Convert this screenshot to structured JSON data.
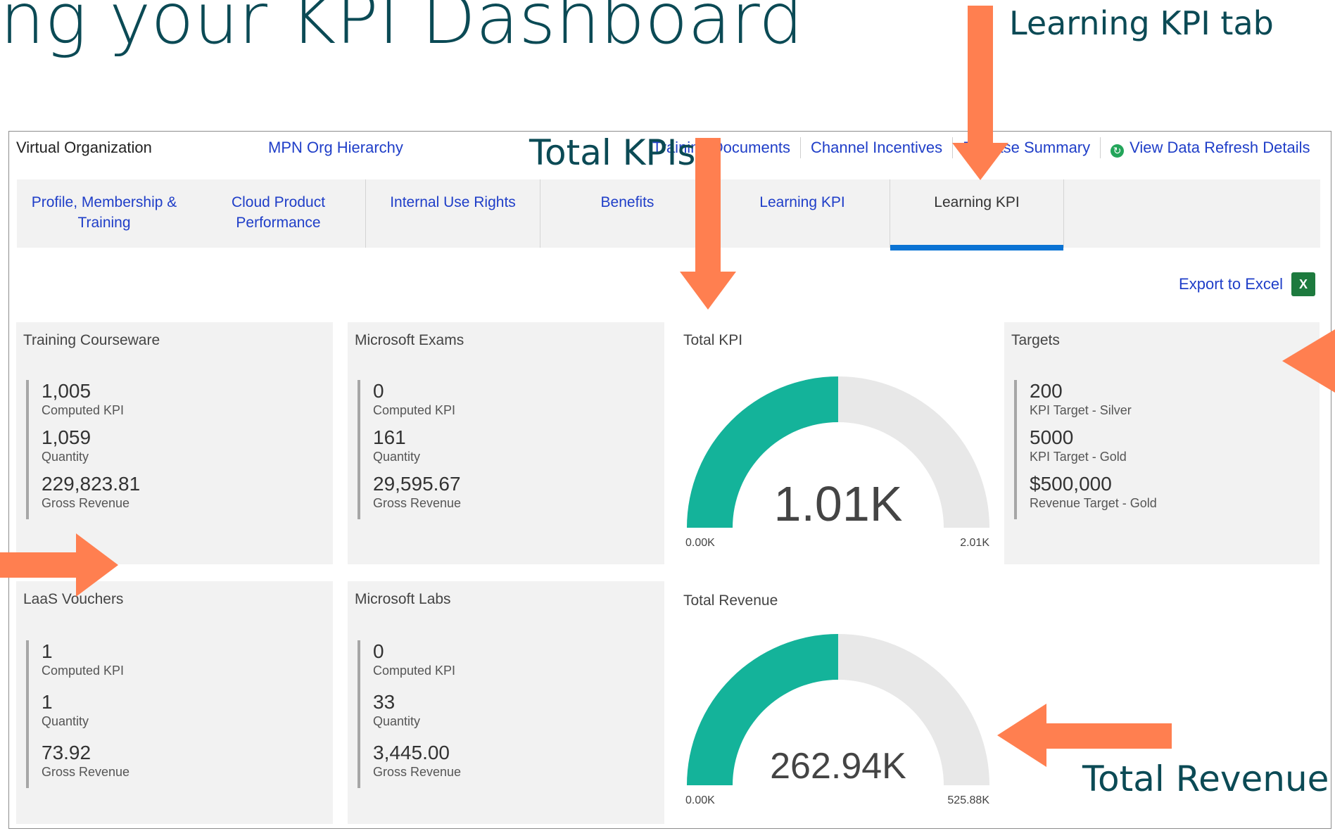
{
  "slide": {
    "title": "ng your KPI Dashboard"
  },
  "callouts": {
    "learning_kpi_tab": "Learning KPI tab",
    "total_kpis": "Total KPIs",
    "total_revenue": "Total Revenue"
  },
  "colors": {
    "arrow": "#ff7f50",
    "gauge_fill": "#14b39a",
    "gauge_track": "#e8e8e8",
    "tab_active_underline": "#0a73d4",
    "link": "#1f3ec8",
    "title": "#0b4a55"
  },
  "topbar": {
    "org_label": "Virtual Organization",
    "hierarchy_link": "MPN Org Hierarchy",
    "links": [
      "Training Documents",
      "Channel Incentives",
      "Release Summary"
    ],
    "refresh_link": "View Data Refresh Details",
    "refresh_icon": "refresh-icon"
  },
  "tabs": [
    {
      "label": "Profile, Membership & Training",
      "active": false
    },
    {
      "label": "Cloud Product Performance",
      "active": false
    },
    {
      "label": "Internal Use Rights",
      "active": false
    },
    {
      "label": "Benefits",
      "active": false
    },
    {
      "label": "Learning KPI",
      "active": false
    },
    {
      "label": "Learning KPI",
      "active": true
    }
  ],
  "export": {
    "label": "Export to Excel",
    "icon": "excel-icon"
  },
  "cards": {
    "training_courseware": {
      "title": "Training Courseware",
      "metrics": [
        {
          "value": "1,005",
          "label": "Computed KPI"
        },
        {
          "value": "1,059",
          "label": "Quantity"
        },
        {
          "value": "229,823.81",
          "label": "Gross Revenue"
        }
      ]
    },
    "microsoft_exams": {
      "title": "Microsoft Exams",
      "metrics": [
        {
          "value": "0",
          "label": "Computed KPI"
        },
        {
          "value": "161",
          "label": "Quantity"
        },
        {
          "value": "29,595.67",
          "label": "Gross Revenue"
        }
      ]
    },
    "targets": {
      "title": "Targets",
      "metrics": [
        {
          "value": "200",
          "label": "KPI Target - Silver"
        },
        {
          "value": "5000",
          "label": "KPI Target - Gold"
        },
        {
          "value": "$500,000",
          "label": "Revenue Target - Gold"
        }
      ]
    },
    "laas_vouchers": {
      "title": "LaaS Vouchers",
      "metrics": [
        {
          "value": "1",
          "label": "Computed KPI"
        },
        {
          "value": "1",
          "label": "Quantity"
        },
        {
          "value": "73.92",
          "label": "Gross Revenue"
        }
      ]
    },
    "microsoft_labs": {
      "title": "Microsoft Labs",
      "metrics": [
        {
          "value": "0",
          "label": "Computed KPI"
        },
        {
          "value": "33",
          "label": "Quantity"
        },
        {
          "value": "3,445.00",
          "label": "Gross Revenue"
        }
      ]
    }
  },
  "gauges": {
    "total_kpi": {
      "title": "Total KPI",
      "value_label": "1.01K",
      "min_label": "0.00K",
      "max_label": "2.01K",
      "fraction": 0.5
    },
    "total_revenue": {
      "title": "Total Revenue",
      "value_label": "262.94K",
      "min_label": "0.00K",
      "max_label": "525.88K",
      "fraction": 0.5
    }
  }
}
